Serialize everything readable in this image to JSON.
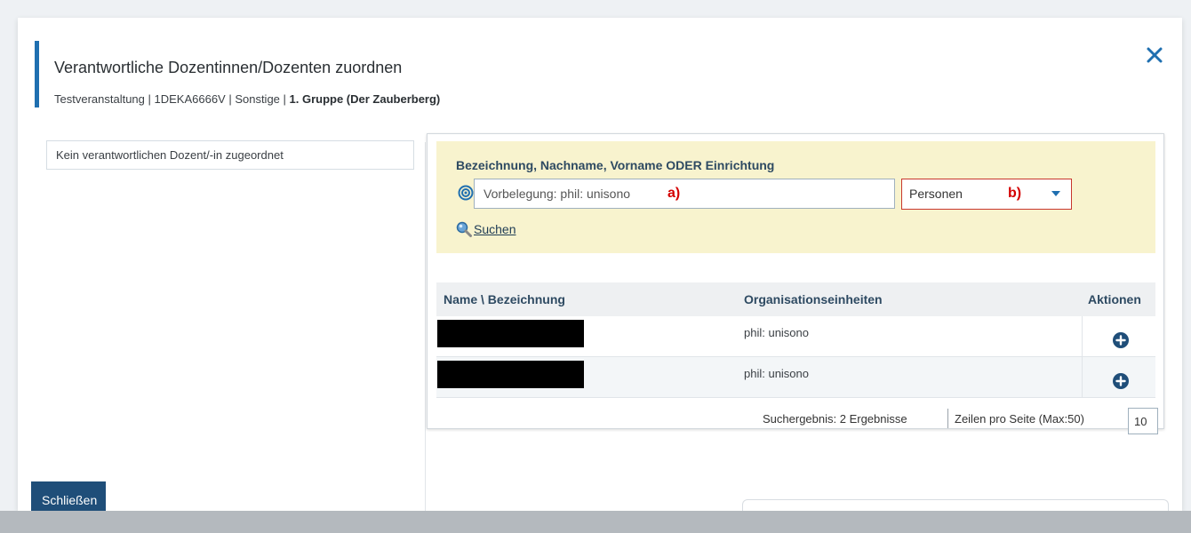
{
  "dialog": {
    "title": "Verantwortliche Dozentinnen/Dozenten zuordnen",
    "subtitle_plain": "Testveranstaltung | 1DEKA6666V | Sonstige | ",
    "subtitle_bold": "1. Gruppe (Der Zauberberg)",
    "close_icon": "close-x-icon"
  },
  "left_panel": {
    "empty_message": "Kein verantwortlichen Dozent/-in zugeordnet"
  },
  "search": {
    "label": "Bezeichnung, Nachname, Vorname ODER Einrichtung",
    "input_value": "Vorbelegung: phil: unisono",
    "marker_a": "a)",
    "select_value": "Personen",
    "marker_b": "b)",
    "button_label": "Suchen"
  },
  "table": {
    "columns": [
      "Name \\ Bezeichnung",
      "Organisationseinheiten",
      "Aktionen"
    ],
    "rows": [
      {
        "name": "",
        "org": "phil: unisono",
        "action": "add-icon"
      },
      {
        "name": "",
        "org": "phil: unisono",
        "action": "add-icon"
      }
    ]
  },
  "footer": {
    "result_text": "Suchergebnis: 2 Ergebnisse",
    "rows_label": "Zeilen pro Seite (Max:50)",
    "rows_value": "10"
  },
  "actions": {
    "close_button": "Schließen"
  },
  "colors": {
    "accent": "#1f6fb0",
    "search_bg": "#f8f3ce",
    "marker": "#d40000",
    "button_bg": "#1f4e79"
  }
}
